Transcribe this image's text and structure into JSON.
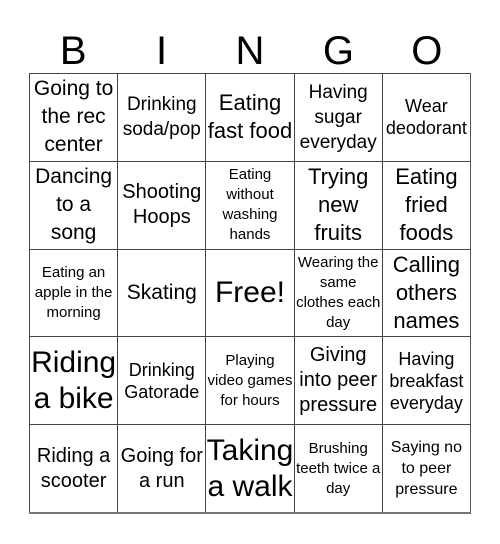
{
  "header": {
    "letters": [
      "B",
      "I",
      "N",
      "G",
      "O"
    ]
  },
  "board": {
    "rows": [
      [
        "Going to the rec center",
        "Drinking soda/pop",
        "Eating fast food",
        "Having sugar everyday",
        "Wear deodorant"
      ],
      [
        "Dancing to a song",
        "Shooting Hoops",
        "Eating without washing hands",
        "Trying new fruits",
        "Eating fried foods"
      ],
      [
        "Eating an apple in the morning",
        "Skating",
        "Free!",
        "Wearing the same clothes each day",
        "Calling others names"
      ],
      [
        "Riding a bike",
        "Drinking Gatorade",
        "Playing video games for hours",
        "Giving into peer pressure",
        "Having breakfast everyday"
      ],
      [
        "Riding a scooter",
        "Going for a run",
        "Taking a walk",
        "Brushing teeth twice a day",
        "Saying no to peer pressure"
      ]
    ]
  }
}
